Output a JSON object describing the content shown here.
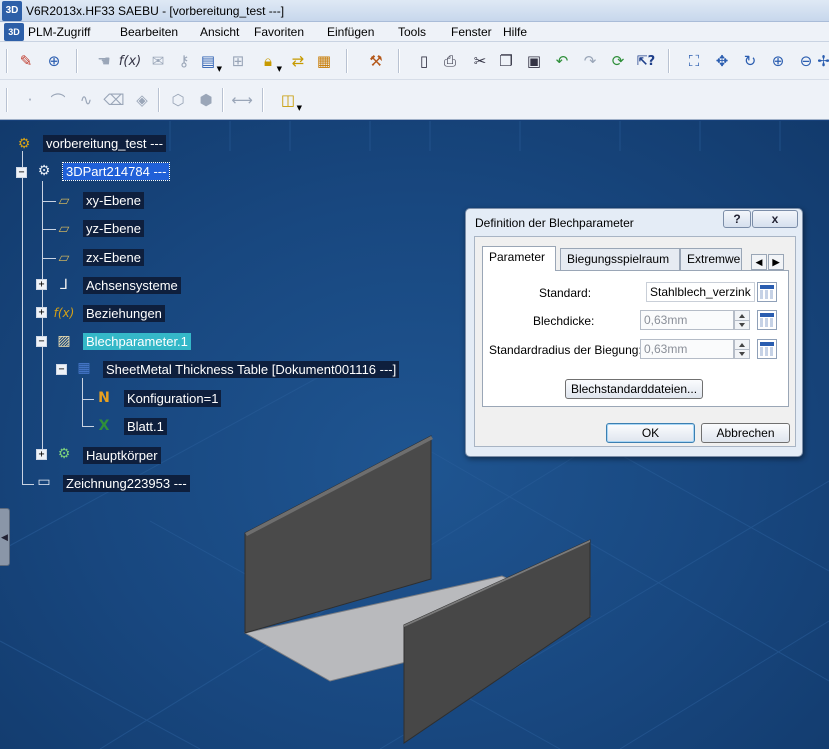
{
  "window": {
    "title": "V6R2013x.HF33 SAEBU - [vorbereitung_test ---]"
  },
  "menu": {
    "items": [
      {
        "label": "PLM-Zugriff"
      },
      {
        "label": "Bearbeiten"
      },
      {
        "label": "Ansicht"
      },
      {
        "label": "Favoriten"
      },
      {
        "label": "Einfügen"
      },
      {
        "label": "Tools"
      },
      {
        "label": "Fenster"
      },
      {
        "label": "Hilfe"
      }
    ]
  },
  "toolbar": {
    "row1": [
      "sketch-icon",
      "compass-icon",
      "pan-hand-icon",
      "formula-fx-icon",
      "comment-icon",
      "measure-icon",
      "window-icon",
      "tree-icon",
      "lock-icon",
      "switch-icon",
      "clipboard-icon",
      "tool-box-icon",
      "new-file-icon",
      "print-icon",
      "cut-icon",
      "copy-icon",
      "paste-icon",
      "undo-icon",
      "redo-icon",
      "refresh-icon",
      "whats-this-icon",
      "fit-all-icon",
      "pan-icon",
      "rotate-icon",
      "zoom-in-icon",
      "zoom-out-icon"
    ],
    "row2": [
      "point-icon",
      "curve-icon",
      "spline-icon",
      "eraser-icon",
      "surface-icon",
      "cube-icon",
      "cube-open-icon",
      "dimension-icon",
      "render-style-icon"
    ]
  },
  "tree": {
    "root": "vorbereitung_test ---",
    "part": "3DPart214784 ---",
    "planes": [
      "xy-Ebene",
      "yz-Ebene",
      "zx-Ebene"
    ],
    "axis_systems": "Achsensysteme",
    "relations": "Beziehungen",
    "sheetmetal_params": "Blechparameter.1",
    "thickness_table": "SheetMetal Thickness Table [Dokument001116 ---]",
    "configuration": "Konfiguration=1",
    "sheet": "Blatt.1",
    "main_body": "Hauptkörper",
    "drawing": "Zeichnung223953 ---"
  },
  "dialog": {
    "title": "Definition der Blechparameter",
    "help_label": "?",
    "close_label": "x",
    "tabs": [
      "Parameter",
      "Biegungsspielraum",
      "Extremwer"
    ],
    "active_tab": "Parameter",
    "fields": {
      "standard_label": "Standard:",
      "standard_value": "Stahlblech_verzink",
      "thickness_label": "Blechdicke:",
      "thickness_value": "0,63mm",
      "bend_radius_label": "Standardradius der Biegung:",
      "bend_radius_value": "0,63mm"
    },
    "standards_button": "Blechstandarddateien...",
    "ok_label": "OK",
    "cancel_label": "Abbrechen"
  },
  "colors": {
    "background": "#16407a",
    "selected_root": "#2060d8",
    "selected_param": "#35b8c8",
    "part_wall": "#4a4a4a",
    "part_floor": "#b9babd"
  }
}
